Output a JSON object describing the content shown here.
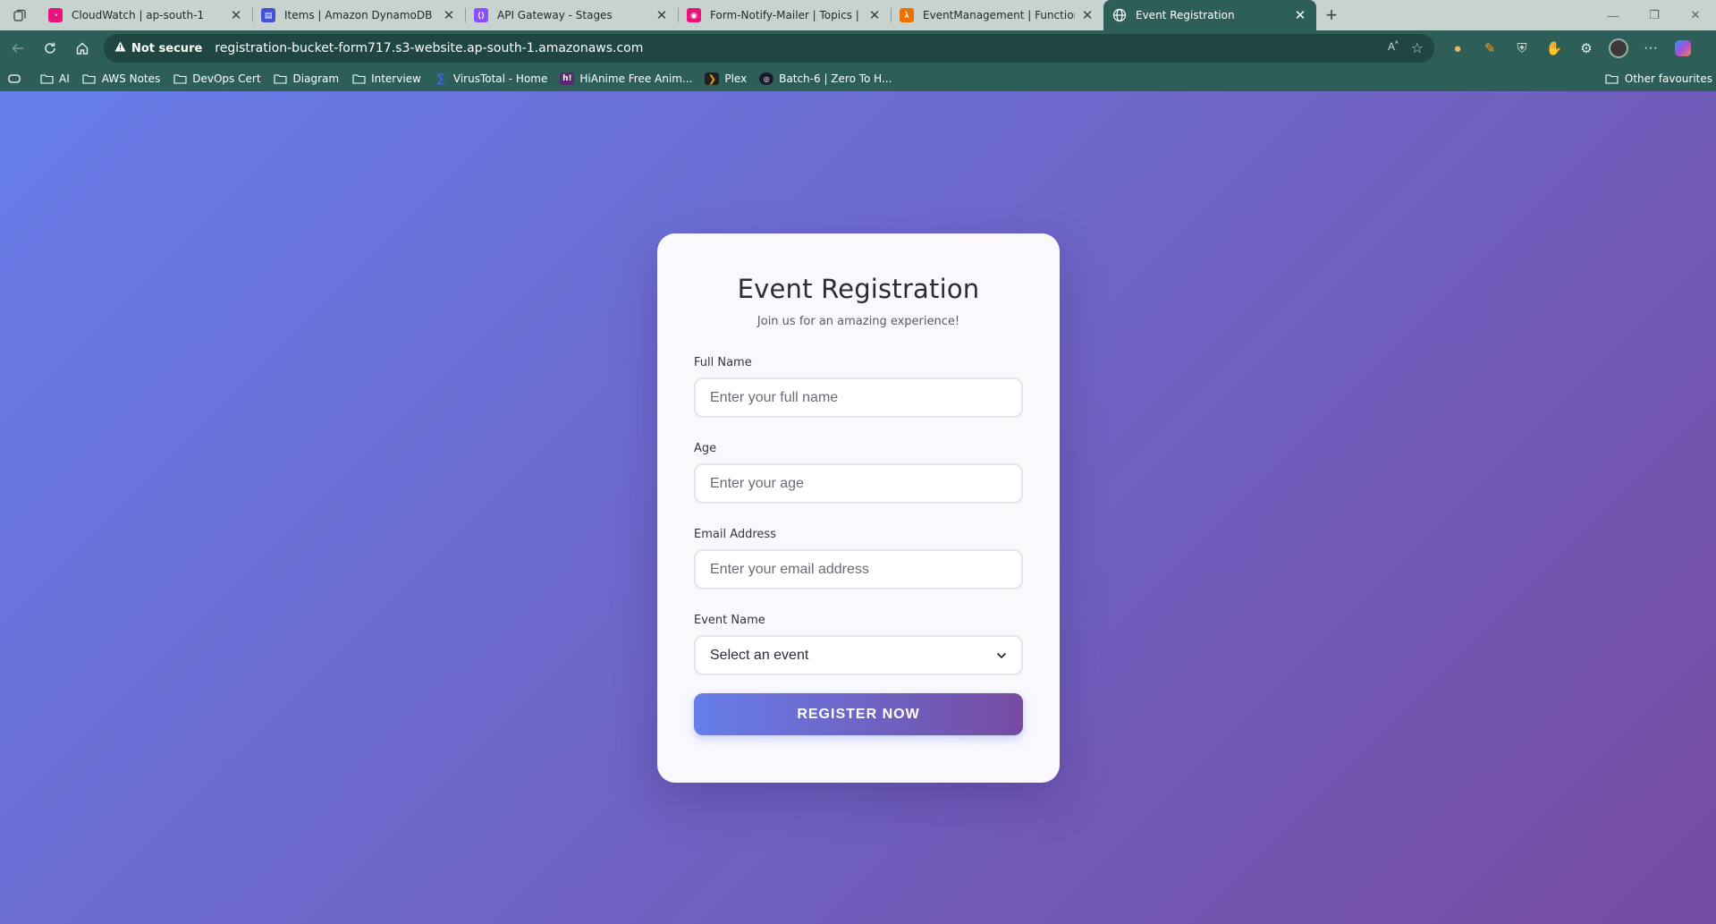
{
  "browser": {
    "tabs": [
      {
        "title": "CloudWatch | ap-south-1",
        "favicon": "cloudwatch-icon",
        "color": "#e7157b",
        "active": false
      },
      {
        "title": "Items | Amazon DynamoDB Management Console",
        "favicon": "dynamodb-icon",
        "color": "#4053d6",
        "active": false
      },
      {
        "title": "API Gateway - Stages",
        "favicon": "api-gateway-icon",
        "color": "#8c4fff",
        "active": false
      },
      {
        "title": "Form-Notify-Mailer | Topics | Simple Notification Service",
        "favicon": "sns-icon",
        "color": "#e7157b",
        "active": false
      },
      {
        "title": "EventManagement | Functions | Lambda",
        "favicon": "lambda-icon",
        "color": "#ed7100",
        "active": false
      },
      {
        "title": "Event Registration",
        "favicon": "globe-icon",
        "color": "#2e5e58",
        "active": true
      }
    ],
    "security_label": "Not secure",
    "url": "registration-bucket-form717.s3-website.ap-south-1.amazonaws.com",
    "bookmarks": [
      {
        "label": "AI",
        "icon": "folder-icon"
      },
      {
        "label": "AWS Notes",
        "icon": "folder-icon"
      },
      {
        "label": "DevOps Cert",
        "icon": "folder-icon"
      },
      {
        "label": "Diagram",
        "icon": "folder-icon"
      },
      {
        "label": "Interview",
        "icon": "folder-icon"
      },
      {
        "label": "VirusTotal - Home",
        "icon": "virustotal-icon"
      },
      {
        "label": "HiAnime Free Anim...",
        "icon": "hianime-icon"
      },
      {
        "label": "Plex",
        "icon": "plex-icon"
      },
      {
        "label": "Batch-6 | Zero To H...",
        "icon": "batch-icon"
      }
    ],
    "other_favourites": "Other favourites"
  },
  "form": {
    "title": "Event Registration",
    "subtitle": "Join us for an amazing experience!",
    "full_name_label": "Full Name",
    "full_name_placeholder": "Enter your full name",
    "age_label": "Age",
    "age_placeholder": "Enter your age",
    "email_label": "Email Address",
    "email_placeholder": "Enter your email address",
    "event_label": "Event Name",
    "event_selected": "Select an event",
    "submit_label": "REGISTER NOW"
  },
  "colors": {
    "gradient_start": "#667eea",
    "gradient_end": "#764ba2",
    "browser_chrome": "#2e5e58"
  }
}
